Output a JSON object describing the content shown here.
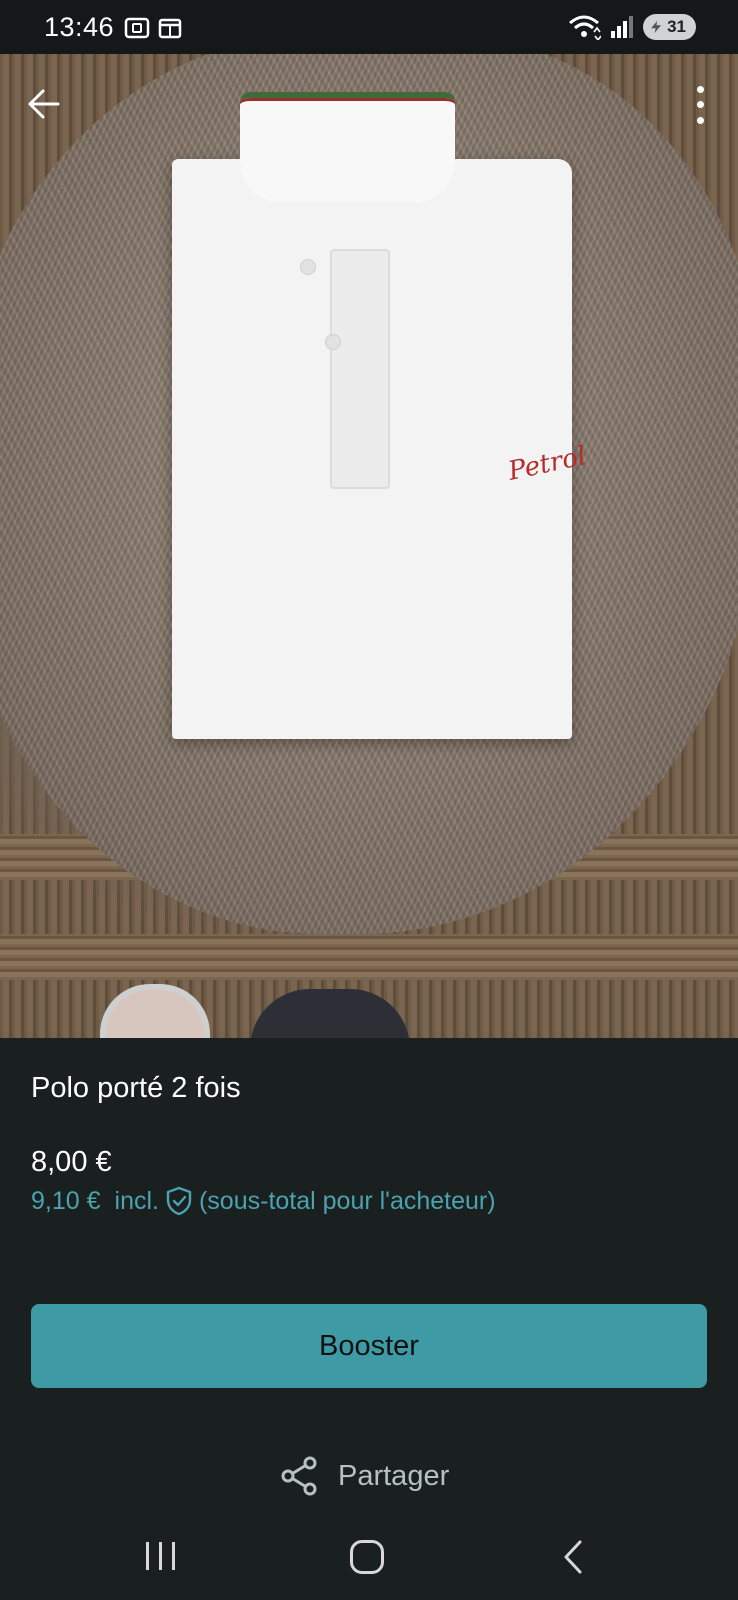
{
  "status_bar": {
    "time": "13:46",
    "battery_level": "31",
    "icons": [
      "screenshot-icon",
      "calendar-icon",
      "wifi-icon",
      "signal-icon",
      "battery-icon"
    ]
  },
  "photo": {
    "icons": [
      "back-arrow-icon",
      "more-vertical-icon"
    ],
    "brand_script": "Petrol"
  },
  "item": {
    "title": "Polo porté 2 fois",
    "price": "8,00 €",
    "buyer_price": "9,10 €",
    "incl_label": "incl.",
    "buyer_note": "(sous-total pour l'acheteur)"
  },
  "actions": {
    "booster_label": "Booster",
    "share_label": "Partager"
  },
  "nav": {
    "icons": [
      "recents-icon",
      "home-icon",
      "back-icon"
    ]
  },
  "colors": {
    "background": "#1a1f1f",
    "accent": "#3e9ba6",
    "accent_text": "#4aa3ad"
  }
}
